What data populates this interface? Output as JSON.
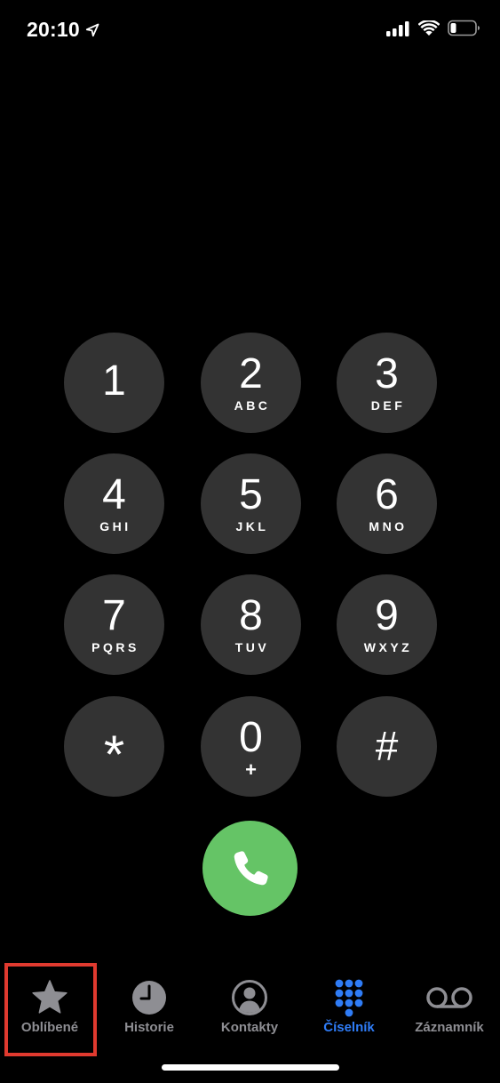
{
  "status_bar": {
    "time": "20:10",
    "location_icon": "location-arrow-icon",
    "signal_icon": "cellular-signal-icon",
    "wifi_icon": "wifi-icon",
    "battery_icon": "battery-low-icon"
  },
  "keypad": {
    "keys": [
      {
        "digit": "1",
        "letters": ""
      },
      {
        "digit": "2",
        "letters": "ABC"
      },
      {
        "digit": "3",
        "letters": "DEF"
      },
      {
        "digit": "4",
        "letters": "GHI"
      },
      {
        "digit": "5",
        "letters": "JKL"
      },
      {
        "digit": "6",
        "letters": "MNO"
      },
      {
        "digit": "7",
        "letters": "PQRS"
      },
      {
        "digit": "8",
        "letters": "TUV"
      },
      {
        "digit": "9",
        "letters": "WXYZ"
      },
      {
        "digit": "*",
        "letters": ""
      },
      {
        "digit": "0",
        "letters": "+"
      },
      {
        "digit": "#",
        "letters": ""
      }
    ]
  },
  "call_button": {
    "icon": "phone-icon",
    "color": "#65c466"
  },
  "tab_bar": {
    "tabs": [
      {
        "label": "Oblíbené",
        "icon": "star-icon",
        "active": false
      },
      {
        "label": "Historie",
        "icon": "clock-icon",
        "active": false
      },
      {
        "label": "Kontakty",
        "icon": "person-circle-icon",
        "active": false
      },
      {
        "label": "Číselník",
        "icon": "keypad-grid-icon",
        "active": true
      },
      {
        "label": "Záznamník",
        "icon": "voicemail-icon",
        "active": false
      }
    ],
    "active_color": "#2f7cf6",
    "inactive_color": "#8e8e93",
    "highlight_color": "#e03a2f"
  }
}
